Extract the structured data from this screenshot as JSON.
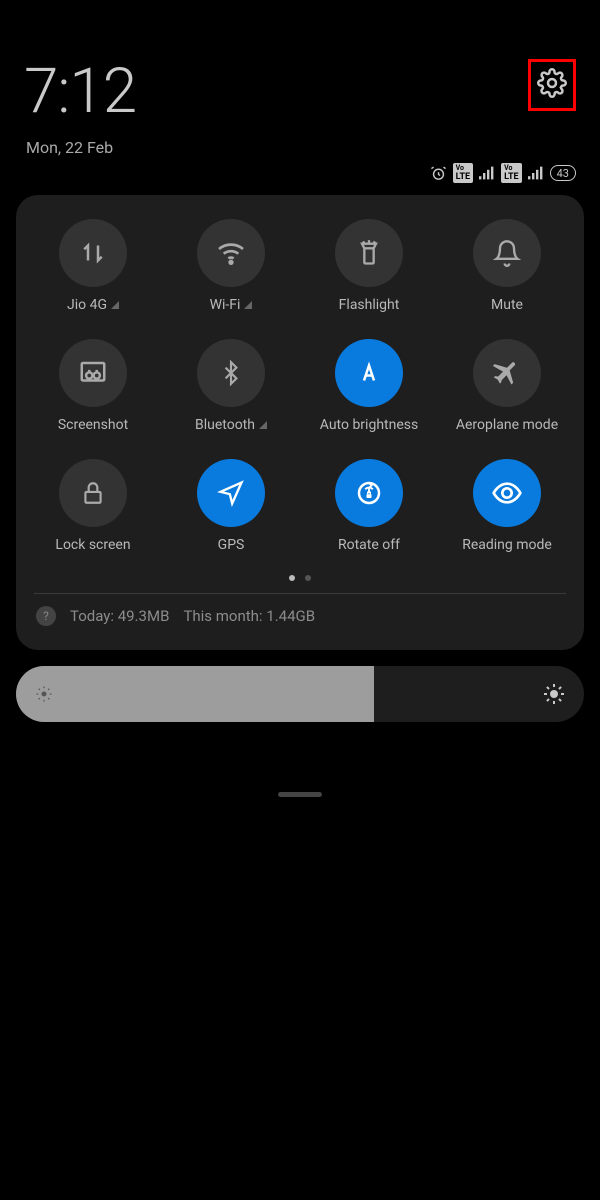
{
  "header": {
    "time": "7:12",
    "date": "Mon, 22 Feb"
  },
  "status": {
    "battery": "43",
    "sim1_net": "Vo LTE",
    "sim2_net": "Vo LTE"
  },
  "tiles": [
    {
      "id": "mobile-data",
      "label": "Jio 4G",
      "active": false,
      "sub_triangle": true
    },
    {
      "id": "wifi",
      "label": "Wi-Fi",
      "active": false,
      "sub_triangle": true
    },
    {
      "id": "flashlight",
      "label": "Flashlight",
      "active": false,
      "sub_triangle": false
    },
    {
      "id": "mute",
      "label": "Mute",
      "active": false,
      "sub_triangle": false
    },
    {
      "id": "screenshot",
      "label": "Screenshot",
      "active": false,
      "sub_triangle": false
    },
    {
      "id": "bluetooth",
      "label": "Bluetooth",
      "active": false,
      "sub_triangle": true
    },
    {
      "id": "auto-bright",
      "label": "Auto brightness",
      "active": true,
      "sub_triangle": false
    },
    {
      "id": "airplane",
      "label": "Aeroplane mode",
      "active": false,
      "sub_triangle": false
    },
    {
      "id": "lock",
      "label": "Lock screen",
      "active": false,
      "sub_triangle": false
    },
    {
      "id": "gps",
      "label": "GPS",
      "active": true,
      "sub_triangle": false
    },
    {
      "id": "rotate",
      "label": "Rotate off",
      "active": true,
      "sub_triangle": false
    },
    {
      "id": "reading",
      "label": "Reading mode",
      "active": true,
      "sub_triangle": false
    }
  ],
  "pager": {
    "pages": 2,
    "current": 0
  },
  "data_usage": {
    "today_label": "Today: 49.3MB",
    "month_label": "This month: 1.44GB"
  },
  "brightness": {
    "percent": 63
  },
  "highlight": {
    "target": "settings-button"
  }
}
